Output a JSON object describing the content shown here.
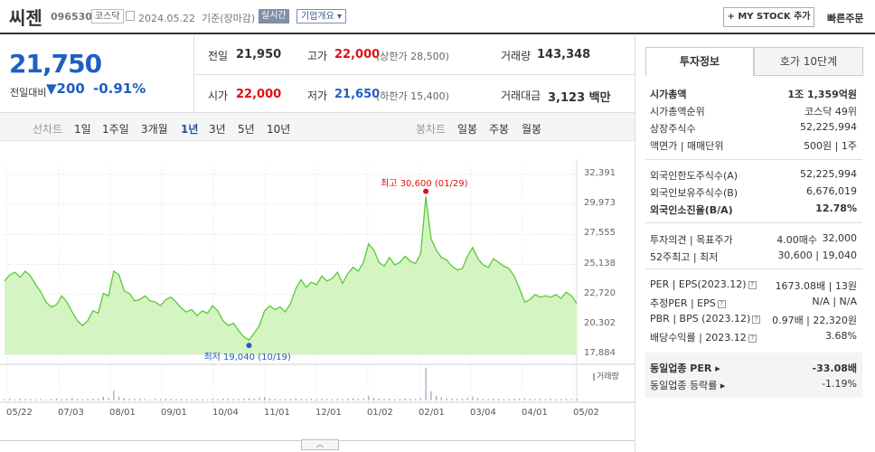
{
  "header": {
    "name": "씨젠",
    "code": "096530",
    "market": "코스닥",
    "date": "2024.05.22",
    "basis": "기준(장마감)",
    "realtime": "실시간",
    "corp_info": "기업개요 ▾",
    "my_stock": "+ MY STOCK 추가",
    "quick_order": "빠른주문"
  },
  "quote": {
    "price": "21,750",
    "change_label": "전일대비",
    "change": "▼200",
    "change_pct": "-0.91%",
    "prev_close_label": "전일",
    "prev_close": "21,950",
    "high_label": "고가",
    "high": "22,000",
    "upper_limit": "(상한가 28,500)",
    "volume_label": "거래량",
    "volume": "143,348",
    "open_label": "시가",
    "open": "22,000",
    "low_label": "저가",
    "low": "21,650",
    "lower_limit": "(하한가 15,400)",
    "amount_label": "거래대금",
    "amount": "3,123",
    "amount_unit": "백만"
  },
  "periods": {
    "line_label": "선차트",
    "items": [
      "1일",
      "1주일",
      "3개월",
      "1년",
      "3년",
      "5년",
      "10년"
    ],
    "selected": "1년",
    "candle_label": "봉차트",
    "candle_items": [
      "일봉",
      "주봉",
      "월봉"
    ]
  },
  "chart_data": {
    "type": "area",
    "title": "",
    "x_ticks": [
      "05/22",
      "07/03",
      "08/01",
      "09/01",
      "10/04",
      "11/01",
      "12/01",
      "01/02",
      "02/01",
      "03/04",
      "04/01",
      "05/02"
    ],
    "y_ticks": [
      "32,391",
      "29,973",
      "27,555",
      "25,138",
      "22,720",
      "20,302",
      "17,884"
    ],
    "ylim": [
      17884,
      32391
    ],
    "high_annotation": "최고 30,600 (01/29)",
    "low_annotation": "최저 19,040 (10/19)",
    "volume_label": "거래량",
    "series": [
      {
        "values": [
          23800,
          24300,
          24500,
          24100,
          24600,
          24200,
          23500,
          22900,
          22100,
          21700,
          21900,
          22600,
          22100,
          21300,
          20600,
          20200,
          20600,
          21400,
          21200,
          22800,
          22600,
          24600,
          24300,
          23000,
          22800,
          22200,
          22300,
          22600,
          22200,
          22100,
          21800,
          22300,
          22500,
          22100,
          21600,
          21300,
          21500,
          21000,
          21400,
          21200,
          21800,
          21400,
          20600,
          20200,
          20400,
          19800,
          19300,
          19040,
          19600,
          20200,
          21400,
          21800,
          21500,
          21700,
          21300,
          22000,
          23200,
          23900,
          23300,
          23700,
          23500,
          24200,
          23800,
          24000,
          24500,
          23600,
          24400,
          24900,
          24600,
          25300,
          26800,
          26300,
          25300,
          25000,
          25700,
          25100,
          25300,
          25800,
          25400,
          25200,
          26000,
          30600,
          27200,
          26300,
          25700,
          25500,
          25000,
          24700,
          24800,
          25800,
          26500,
          25600,
          25100,
          24900,
          25600,
          25300,
          25000,
          24800,
          24200,
          23200,
          22100,
          22300,
          22700,
          22500,
          22600,
          22500,
          22700,
          22400,
          22900,
          22600,
          22000
        ]
      }
    ],
    "volumes": [
      0.04,
      0.05,
      0.03,
      0.06,
      0.04,
      0.05,
      0.03,
      0.04,
      0.03,
      0.05,
      0.06,
      0.04,
      0.05,
      0.07,
      0.05,
      0.04,
      0.05,
      0.06,
      0.05,
      0.12,
      0.08,
      0.3,
      0.12,
      0.08,
      0.05,
      0.06,
      0.05,
      0.04,
      0.03,
      0.05,
      0.04,
      0.06,
      0.05,
      0.04,
      0.05,
      0.04,
      0.03,
      0.05,
      0.04,
      0.03,
      0.05,
      0.04,
      0.06,
      0.05,
      0.04,
      0.05,
      0.06,
      0.07,
      0.06,
      0.09,
      0.11,
      0.07,
      0.05,
      0.04,
      0.05,
      0.06,
      0.07,
      0.05,
      0.04,
      0.05,
      0.04,
      0.06,
      0.05,
      0.04,
      0.05,
      0.04,
      0.06,
      0.07,
      0.05,
      0.06,
      0.14,
      0.08,
      0.06,
      0.05,
      0.06,
      0.04,
      0.05,
      0.06,
      0.05,
      0.04,
      0.07,
      1.0,
      0.28,
      0.15,
      0.1,
      0.07,
      0.06,
      0.05,
      0.05,
      0.08,
      0.12,
      0.07,
      0.05,
      0.04,
      0.06,
      0.05,
      0.04,
      0.05,
      0.06,
      0.06,
      0.07,
      0.05,
      0.04,
      0.05,
      0.04,
      0.05,
      0.04,
      0.04,
      0.05,
      0.04,
      0.05
    ]
  },
  "invest": {
    "tab_info": "투자정보",
    "tab_orderbook": "호가 10단계",
    "rows1": [
      {
        "label": "시가총액",
        "value": "1조 1,359억원",
        "bold": true
      },
      {
        "label": "시가총액순위",
        "value": "코스닥 49위"
      },
      {
        "label": "상장주식수",
        "value": "52,225,994"
      },
      {
        "label": "액면가 | 매매단위",
        "value": "500원 | 1주"
      }
    ],
    "rows2": [
      {
        "label": "외국인한도주식수(A)",
        "value": "52,225,994"
      },
      {
        "label": "외국인보유주식수(B)",
        "value": "6,676,019"
      },
      {
        "label": "외국인소진율(B/A)",
        "value": "12.78%",
        "bold": true
      }
    ],
    "opinion_label": "투자의견 | 목표주가",
    "opinion_value": "4.00매수",
    "target_value": "32,000",
    "w52_label": "52주최고 | 최저",
    "w52_value": "30,600 | 19,040",
    "per_label": "PER | EPS(2023.12)",
    "per_value": "1673.08배 | 13원",
    "est_label": "추정PER | EPS",
    "est_value": "N/A | N/A",
    "pbr_label": "PBR | BPS (2023.12)",
    "pbr_value": "0.97배 | 22,320원",
    "div_label": "배당수익률 | 2023.12",
    "div_value": "3.68%",
    "sector_per_label": "동일업종 PER",
    "sector_per_value": "-33.08배",
    "sector_rate_label": "동일업종 등락률",
    "sector_rate_value": "-1.19%"
  }
}
